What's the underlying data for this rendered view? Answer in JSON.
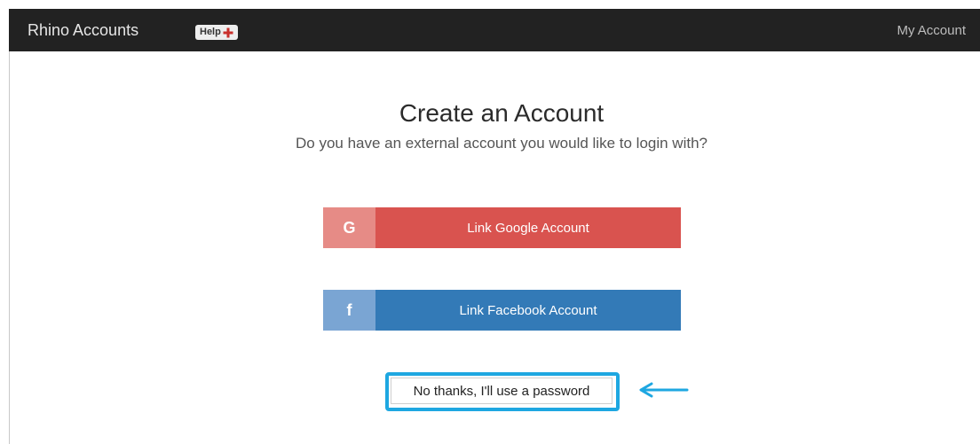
{
  "navbar": {
    "brand": "Rhino Accounts",
    "help_label": "Help",
    "my_account": "My Account"
  },
  "main": {
    "title": "Create an Account",
    "subtitle": "Do you have an external account you would like to login with?",
    "google": {
      "icon_letter": "G",
      "label": "Link Google Account"
    },
    "facebook": {
      "icon_letter": "f",
      "label": "Link Facebook Account"
    },
    "password_button": "No thanks, I'll use a password"
  },
  "colors": {
    "navbar_bg": "#222222",
    "google_red": "#d9534f",
    "facebook_blue": "#337ab7",
    "highlight_blue": "#1ea7e1",
    "help_plus_red": "#c9302c"
  }
}
